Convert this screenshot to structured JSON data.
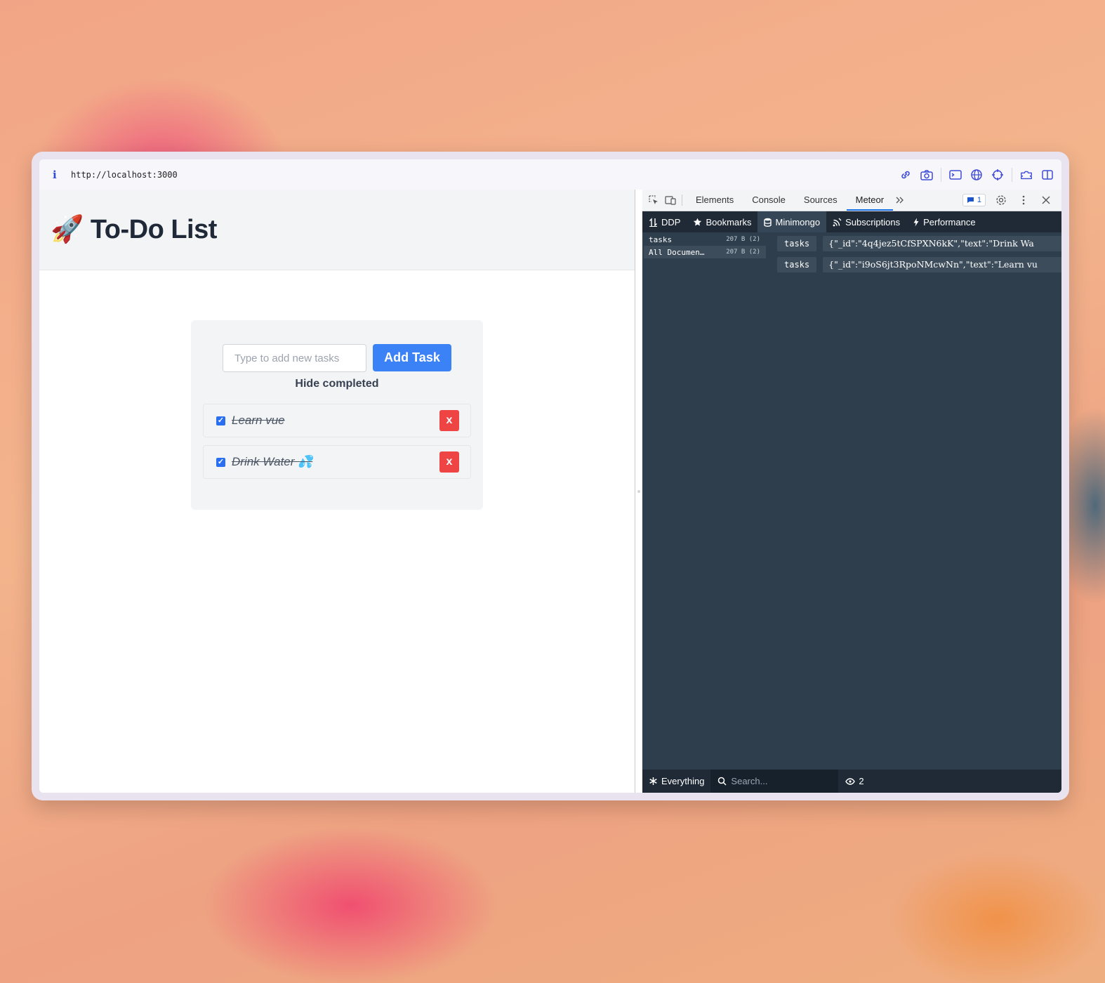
{
  "browser": {
    "url": "http://localhost:3000"
  },
  "app": {
    "title": "🚀 To-Do List",
    "input_placeholder": "Type to add new tasks",
    "add_button": "Add Task",
    "hide_completed": "Hide completed",
    "tasks": [
      {
        "text": "Learn vue",
        "checked": true,
        "delete_label": "x"
      },
      {
        "text": "Drink Water 💦",
        "checked": true,
        "delete_label": "x"
      }
    ]
  },
  "devtools": {
    "tabs": [
      "Elements",
      "Console",
      "Sources",
      "Meteor"
    ],
    "active_tab": "Meteor",
    "issues_count": "1",
    "meteor_nav": [
      "DDP",
      "Bookmarks",
      "Minimongo",
      "Subscriptions",
      "Performance"
    ],
    "active_nav": "Minimongo",
    "collections": [
      {
        "name": "tasks",
        "size": "207 B (2)"
      },
      {
        "name": "All Documen…",
        "size": "207 B (2)"
      }
    ],
    "documents": [
      {
        "collection": "tasks",
        "json": "{\"_id\":\"4q4jez5tCfSPXN6kK\",\"text\":\"Drink Wa"
      },
      {
        "collection": "tasks",
        "json": "{\"_id\":\"i9oS6jt3RpoNMcwNn\",\"text\":\"Learn vu"
      }
    ],
    "footer": {
      "filter": "Everything",
      "search_placeholder": "Search...",
      "count": "2"
    }
  },
  "colors": {
    "primary": "#3b82f6",
    "danger": "#ef4444",
    "devtools_bg": "#2e3e4d",
    "devtools_nav": "#1f2a36"
  }
}
